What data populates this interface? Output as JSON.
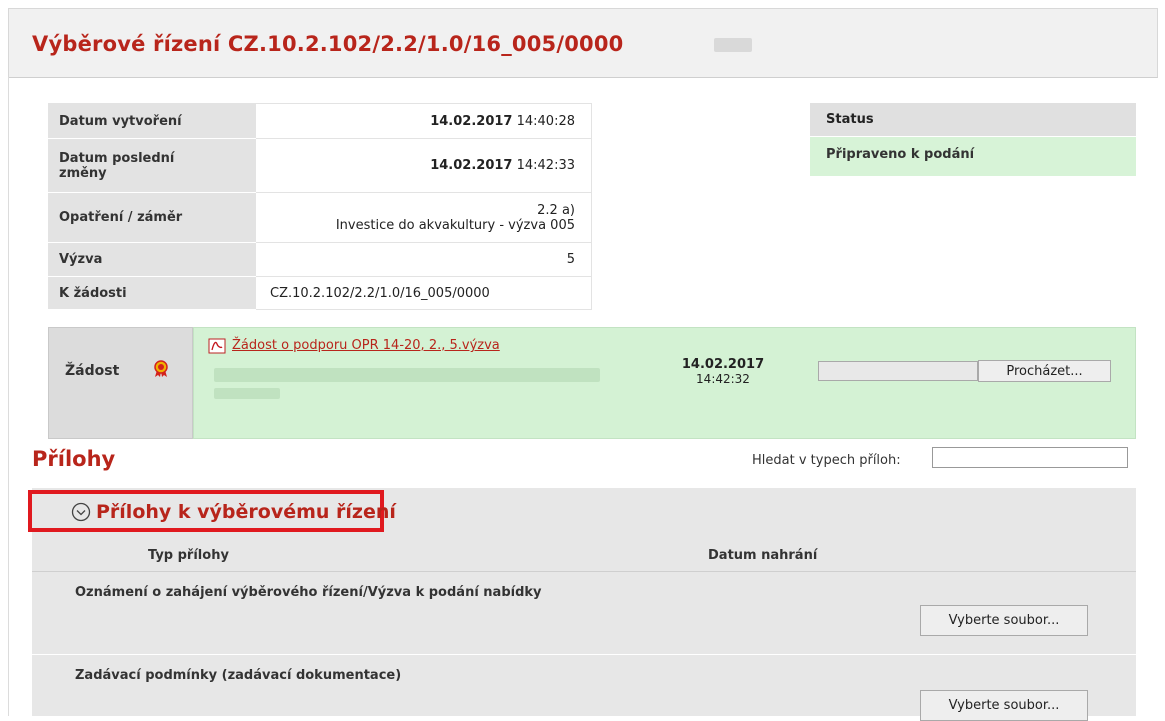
{
  "header": {
    "title": "Výběrové řízení CZ.10.2.102/2.2/1.0/16_005/0000"
  },
  "info": {
    "rows": [
      {
        "label": "Datum vytvoření",
        "value_date": "14.02.2017",
        "value_time": "14:40:28"
      },
      {
        "label_line1": "Datum poslední",
        "label_line2": "změny",
        "value_date": "14.02.2017",
        "value_time": "14:42:33"
      },
      {
        "label": "Opatření / záměr",
        "value_line1": "2.2 a)",
        "value_line2": "Investice do akvakultury - výzva 005"
      },
      {
        "label": "Výzva",
        "value": "5"
      },
      {
        "label": "K žádosti",
        "value": "CZ.10.2.102/2.2/1.0/16_005/0000"
      }
    ]
  },
  "status": {
    "label": "Status",
    "value": "Připraveno k podání",
    "color": "#d7f3d7"
  },
  "zadost": {
    "label": "Žádost",
    "icon": "award-ribbon-icon",
    "file_link": "Žádost o podporu OPR 14-20, 2., 5.výzva",
    "date": "14.02.2017",
    "time": "14:42:32",
    "browse_button": "Procházet..."
  },
  "prilohy": {
    "title": "Přílohy",
    "search_label": "Hledat v typech příloh:",
    "search_value": "",
    "section_title": "Přílohy k výběrovému řízení",
    "col_type": "Typ přílohy",
    "col_date": "Datum nahrání",
    "items": [
      {
        "label": "Oznámení o zahájení výběrového řízení/Výzva k podání nabídky",
        "button": "Vyberte soubor..."
      },
      {
        "label": "Zadávací podmínky (zadávací dokumentace)",
        "button": "Vyberte soubor..."
      }
    ]
  },
  "colors": {
    "accent": "#b8251b",
    "highlight_border": "#e0191f",
    "green_bg": "#d4f2d4"
  }
}
